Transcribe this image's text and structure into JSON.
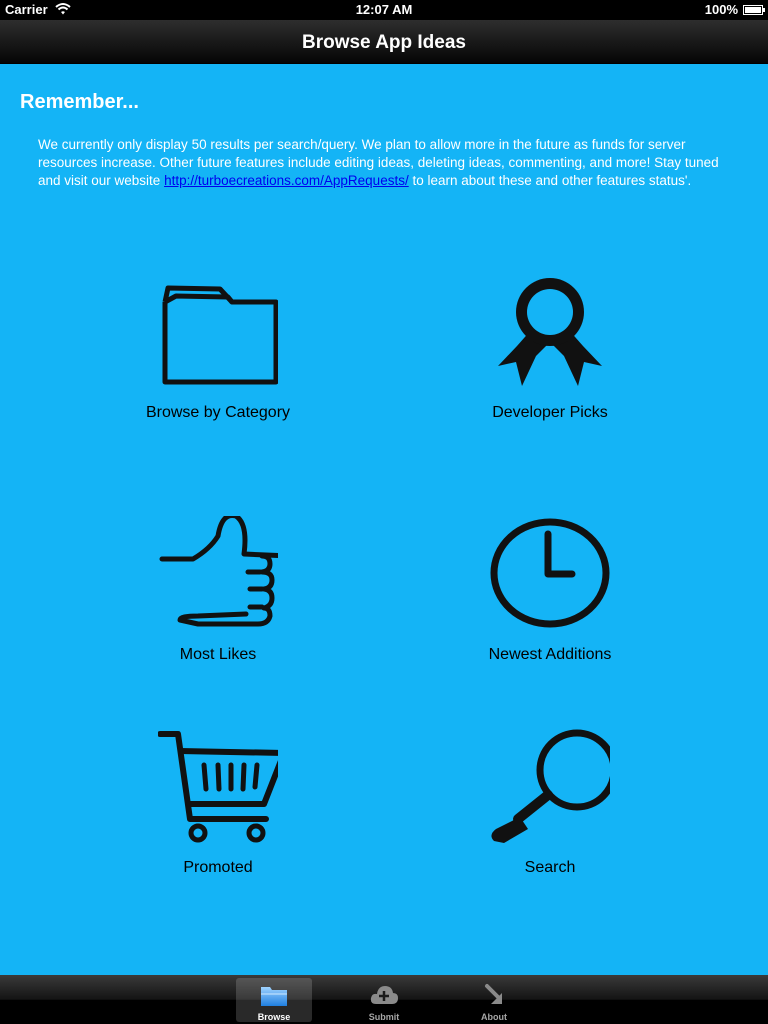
{
  "status_bar": {
    "carrier": "Carrier",
    "time": "12:07 AM",
    "battery": "100%",
    "battery_level": 1.0
  },
  "nav": {
    "title": "Browse App Ideas"
  },
  "notice": {
    "title": "Remember...",
    "text_before": "We currently only display 50 results per search/query. We plan to allow more in the future as funds for server resources increase. Other future features include editing ideas, deleting ideas, commenting, and more! Stay tuned and visit our website ",
    "link": "http://turboecreations.com/AppRequests/",
    "text_after": " to learn about these and other features status'."
  },
  "tiles": [
    {
      "label": "Browse by Category",
      "icon": "folder-icon"
    },
    {
      "label": "Developer Picks",
      "icon": "ribbon-award-icon"
    },
    {
      "label": "Most Likes",
      "icon": "thumbs-up-icon"
    },
    {
      "label": "Newest Additions",
      "icon": "clock-icon"
    },
    {
      "label": "Promoted",
      "icon": "shopping-cart-icon"
    },
    {
      "label": "Search",
      "icon": "magnifier-icon"
    }
  ],
  "tabs": [
    {
      "label": "Browse",
      "icon": "folder-icon",
      "selected": true
    },
    {
      "label": "Submit",
      "icon": "cloud-plus-icon",
      "selected": false
    },
    {
      "label": "About",
      "icon": "arrow-icon",
      "selected": false
    }
  ],
  "colors": {
    "background": "#14b4f6",
    "link": "#0000ee",
    "icon": "#111111"
  }
}
